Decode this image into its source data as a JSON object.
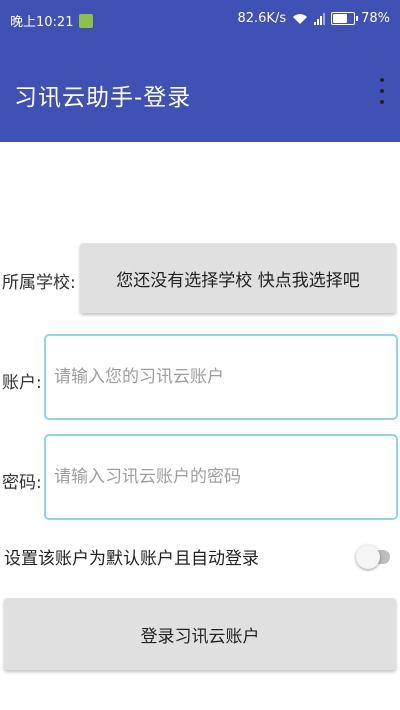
{
  "status_bar": {
    "time": "晚上10:21",
    "speed": "82.6K/s",
    "battery": "78%",
    "battery_level": 0.78,
    "app_icon": "app-notification-icon",
    "wifi_icon": "wifi-icon",
    "signal_icon": "signal-icon"
  },
  "app_bar": {
    "title": "习讯云助手-登录",
    "menu_icon": "overflow-menu-icon",
    "color": "#3f51b5"
  },
  "form": {
    "school": {
      "label": "所属学校:",
      "button_label": "您还没有选择学校 快点我选择吧"
    },
    "account": {
      "label": "账户:",
      "placeholder": "请输入您的习讯云账户",
      "value": ""
    },
    "password": {
      "label": "密码:",
      "placeholder": "请输入习讯云账户的密码",
      "value": ""
    },
    "auto_login": {
      "label": "设置该账户为默认账户且自动登录",
      "checked": false
    },
    "submit_label": "登录习讯云账户",
    "field_border_color": "#8fd3f4"
  }
}
